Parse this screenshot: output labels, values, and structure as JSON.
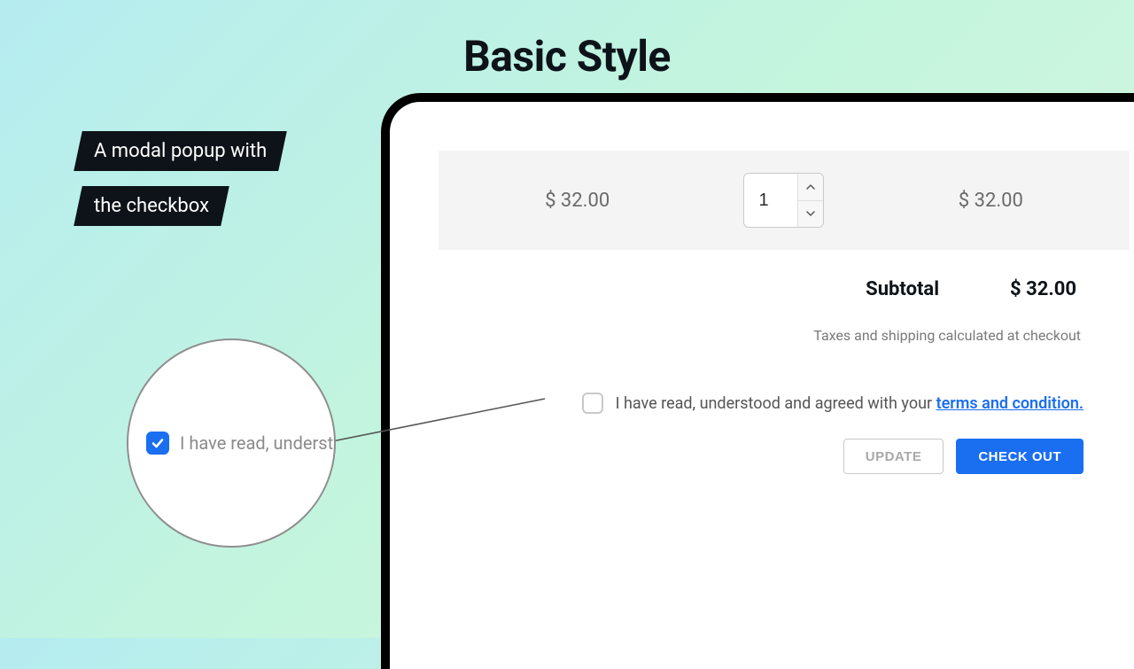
{
  "title": "Basic Style",
  "annotation": {
    "line1": "A modal popup with",
    "line2": "the checkbox"
  },
  "cart": {
    "unit_price": "$ 32.00",
    "quantity": "1",
    "line_total": "$ 32.00",
    "subtotal_label": "Subtotal",
    "subtotal_value": "$ 32.00",
    "tax_note": "Taxes and shipping calculated at checkout",
    "terms_text": "I have read, understood and agreed with your ",
    "terms_link": "terms and condition.",
    "update_label": "Update",
    "checkout_label": "Check Out"
  },
  "zoom": {
    "text": "I have read, underst"
  },
  "colors": {
    "accent": "#1a6ef0"
  }
}
